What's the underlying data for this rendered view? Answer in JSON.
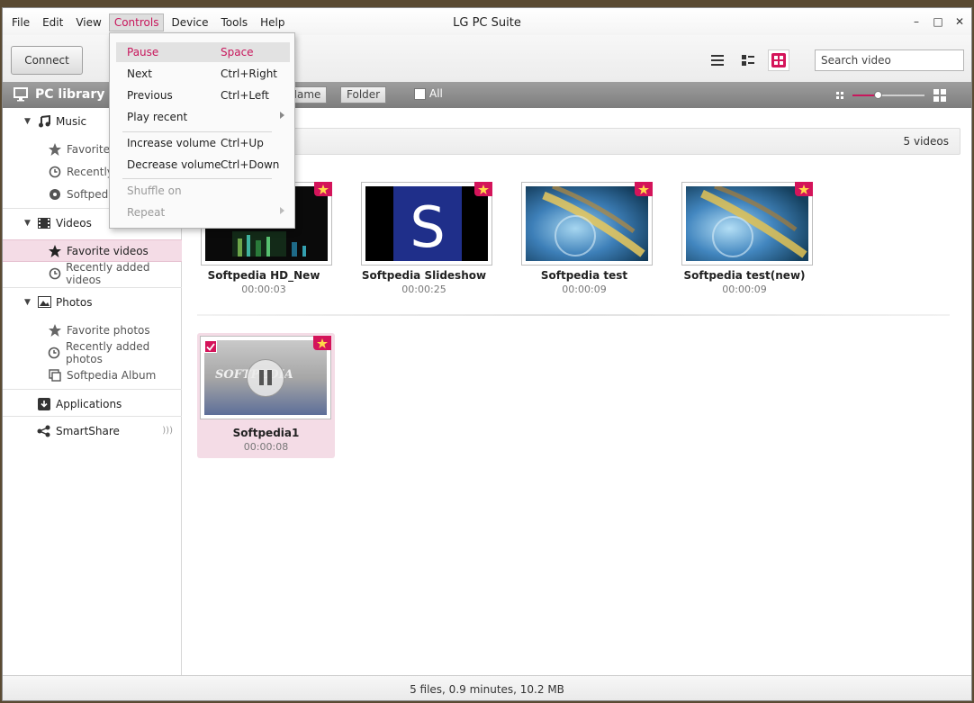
{
  "window": {
    "title": "LG PC Suite",
    "minimize": "–",
    "maximize": "□",
    "close": "✕"
  },
  "menu": [
    "File",
    "Edit",
    "View",
    "Controls",
    "Device",
    "Tools",
    "Help"
  ],
  "controls_menu": {
    "items": [
      {
        "label": "Pause",
        "shortcut": "Space"
      },
      {
        "label": "Next",
        "shortcut": "Ctrl+Right"
      },
      {
        "label": "Previous",
        "shortcut": "Ctrl+Left"
      },
      {
        "label": "Play recent",
        "shortcut": ""
      },
      {
        "label": "Increase volume",
        "shortcut": "Ctrl+Up"
      },
      {
        "label": "Decrease volume",
        "shortcut": "Ctrl+Down"
      },
      {
        "label": "Shuffle on",
        "shortcut": ""
      },
      {
        "label": "Repeat",
        "shortcut": ""
      }
    ]
  },
  "toolbar": {
    "connect_label": "Connect",
    "search_placeholder": "Search video"
  },
  "band": {
    "title": "PC library",
    "sort_name": "Name",
    "sort_folder": "Folder",
    "all_label": "All",
    "zoom_percent": 36
  },
  "sidebar": {
    "music": "Music",
    "music_items": [
      "Favorite",
      "Recently",
      "Softpedia"
    ],
    "videos": "Videos",
    "video_items": [
      "Favorite videos",
      "Recently added videos"
    ],
    "photos": "Photos",
    "photo_items": [
      "Favorite photos",
      "Recently added photos",
      "Softpedia Album"
    ],
    "applications": "Applications",
    "smartshare": "SmartShare"
  },
  "content": {
    "count": "5 videos",
    "videos": [
      {
        "title": "Softpedia HD_New",
        "duration": "00:00:03"
      },
      {
        "title": "Softpedia Slideshow",
        "duration": "00:00:25"
      },
      {
        "title": "Softpedia test",
        "duration": "00:00:09"
      },
      {
        "title": "Softpedia test(new)",
        "duration": "00:00:09"
      },
      {
        "title": "Softpedia1",
        "duration": "00:00:08"
      }
    ],
    "slideshow_letter": "S",
    "softpedia_overlay": "SOFTPEDIA"
  },
  "status": "5 files, 0.9 minutes, 10.2 MB",
  "colors": {
    "accent": "#c8175c",
    "badge": "#d4145a",
    "selected_bg": "#f4dce6"
  }
}
